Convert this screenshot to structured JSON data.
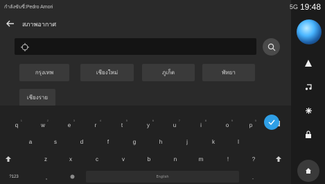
{
  "status": {
    "user": "กำลังขับขี่:Pedro Amori",
    "signal": "5G",
    "time": "19:48"
  },
  "header": {
    "title": "สภาพอากาศ"
  },
  "search": {
    "value": "",
    "placeholder": ""
  },
  "chips": [
    "กรุงเทพ",
    "เชียงใหม่",
    "ภูเก็ต",
    "พัทยา",
    "เชียงราย"
  ],
  "keyboard": {
    "row1": [
      {
        "k": "q",
        "h": "1"
      },
      {
        "k": "w",
        "h": "2"
      },
      {
        "k": "e",
        "h": "3"
      },
      {
        "k": "r",
        "h": "4"
      },
      {
        "k": "t",
        "h": "5"
      },
      {
        "k": "y",
        "h": "6"
      },
      {
        "k": "u",
        "h": "7"
      },
      {
        "k": "i",
        "h": "8"
      },
      {
        "k": "o",
        "h": "9"
      },
      {
        "k": "p",
        "h": "0"
      }
    ],
    "row2": [
      "a",
      "s",
      "d",
      "f",
      "g",
      "h",
      "j",
      "k",
      "l"
    ],
    "row3": [
      "z",
      "x",
      "c",
      "v",
      "b",
      "n",
      "m",
      "!",
      "?"
    ],
    "bottom": {
      "numbers": "?123",
      "comma": ",",
      "space": "English",
      "period": "."
    }
  },
  "colors": {
    "accent": "#2f9fe6",
    "background": "#2a2a2a"
  }
}
